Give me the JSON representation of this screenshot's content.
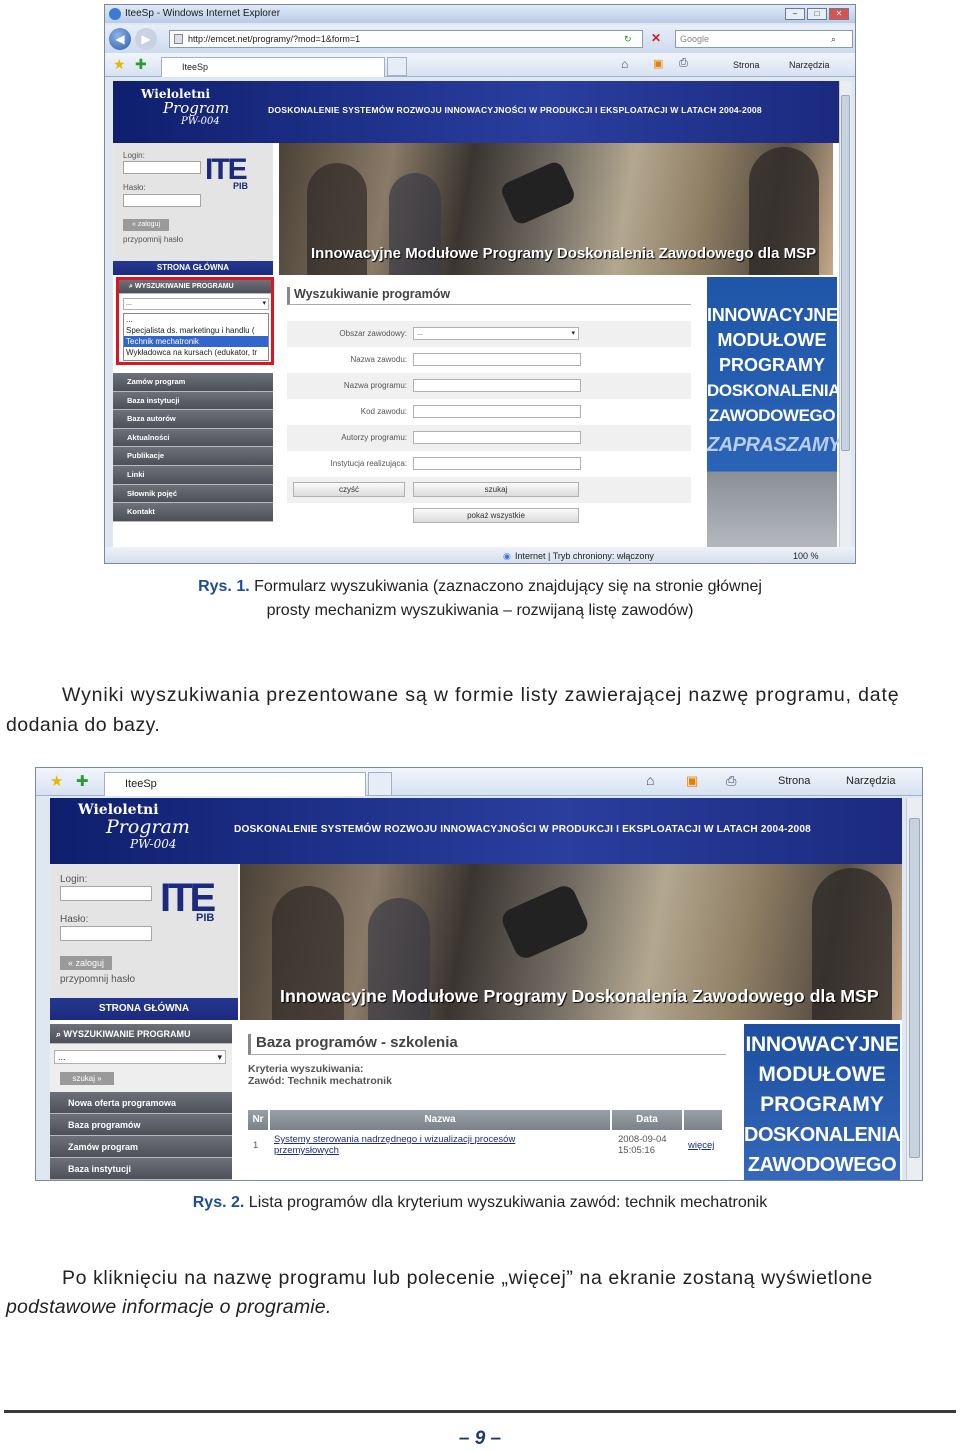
{
  "browser": {
    "title": "IteeSp - Windows Internet Explorer",
    "url": "http://emcet.net/programy/?mod=1&form=1",
    "search_placeholder": "Google",
    "tab_label": "IteeSp",
    "toolbar_page": "Strona",
    "toolbar_tools": "Narzędzia",
    "status_zone": "Internet | Tryb chroniony: włączony",
    "zoom": "100 %"
  },
  "site": {
    "logo_line1": "Wieloletni",
    "logo_line2": "Program",
    "logo_line3": "PW-004",
    "banner_title": "DOSKONALENIE SYSTEMÓW ROZWOJU INNOWACYJNOŚCI W PRODUKCJI I EKSPLOATACJI W LATACH 2004-2008",
    "photo_caption": "Innowacyjne Modułowe Programy Doskonalenia Zawodowego dla MSP",
    "login_label": "Login:",
    "password_label": "Hasło:",
    "login_button": "« zaloguj",
    "remind": "przypomnij hasło",
    "itc_logo": "ITE",
    "itc_sub": "PIB",
    "main_nav": "STRONA GŁÓWNA",
    "search_header": "WYSZUKIWANIE PROGRAMU",
    "search_select": "...",
    "search_button": "szukaj »"
  },
  "shot1": {
    "dropdown_options": [
      "...",
      "Specjalista ds. marketingu i handlu (",
      "Technik mechatronik",
      "Wykładowca na kursach (edukator, tr"
    ],
    "nav_items": [
      "Zamów program",
      "Baza instytucji",
      "Baza autorów",
      "Aktualności",
      "Publikacje",
      "Linki",
      "Słownik pojęć",
      "Kontakt"
    ],
    "form_title": "Wyszukiwanie programów",
    "form_fields": [
      {
        "label": "Obszar zawodowy:",
        "value": "..."
      },
      {
        "label": "Nazwa zawodu:",
        "value": ""
      },
      {
        "label": "Nazwa programu:",
        "value": ""
      },
      {
        "label": "Kod zawodu:",
        "value": ""
      },
      {
        "label": "Autorzy programu:",
        "value": ""
      },
      {
        "label": "Instytucja realizująca:",
        "value": ""
      }
    ],
    "clear_button": "czyść",
    "search_button": "szukaj",
    "show_all_button": "pokaż wszystkie",
    "promo_lines": [
      "INNOWACYJNE",
      "MODUŁOWE",
      "PROGRAMY",
      "DOSKONALENIA",
      "ZAWODOWEGO"
    ],
    "promo_invite": "ZAPRASZAMY"
  },
  "caption1": {
    "label": "Rys. 1.",
    "line1": "Formularz wyszukiwania (zaznaczono znajdujący się na stronie głównej",
    "line2": "prosty mechanizm wyszukiwania – rozwijaną listę zawodów)"
  },
  "paragraph1": {
    "line1": "Wyniki wyszukiwania prezentowane są w formie listy zawierającej nazwę programu, datę",
    "line2": "dodania do bazy."
  },
  "shot2": {
    "nav_items": [
      "Nowa oferta programowa",
      "Baza programów",
      "Zamów program",
      "Baza instytucji"
    ],
    "title": "Baza programów - szkolenia",
    "criteria_label": "Kryteria wyszukiwania:",
    "criteria_value": "Zawód: Technik mechatronik",
    "columns": [
      "Nr",
      "Nazwa",
      "Data"
    ],
    "rows": [
      {
        "nr": "1",
        "name_line1": "Systemy sterowania nadrzędnego i wizualizacji procesów",
        "name_line2": "przemysłowych",
        "date": "2008-09-04",
        "time": "15:05:16",
        "more": "więcej"
      }
    ],
    "promo_lines": [
      "INNOWACYJNE",
      "MODUŁOWE",
      "PROGRAMY",
      "DOSKONALENIA",
      "ZAWODOWEGO"
    ]
  },
  "caption2": {
    "label": "Rys. 2.",
    "text": "Lista programów dla kryterium wyszukiwania zawód: technik mechatronik"
  },
  "paragraph2": {
    "line1": "Po kliknięciu na nazwę programu lub polecenie „więcej” na ekranie zostaną wyświetlone",
    "line2": "podstawowe informacje o programie."
  },
  "footer": {
    "page_number": "– 9 –"
  },
  "colors": {
    "site_blue": "#1b2a7f",
    "highlight_red": "#e0141e",
    "caption_blue": "#1e4d9b"
  }
}
